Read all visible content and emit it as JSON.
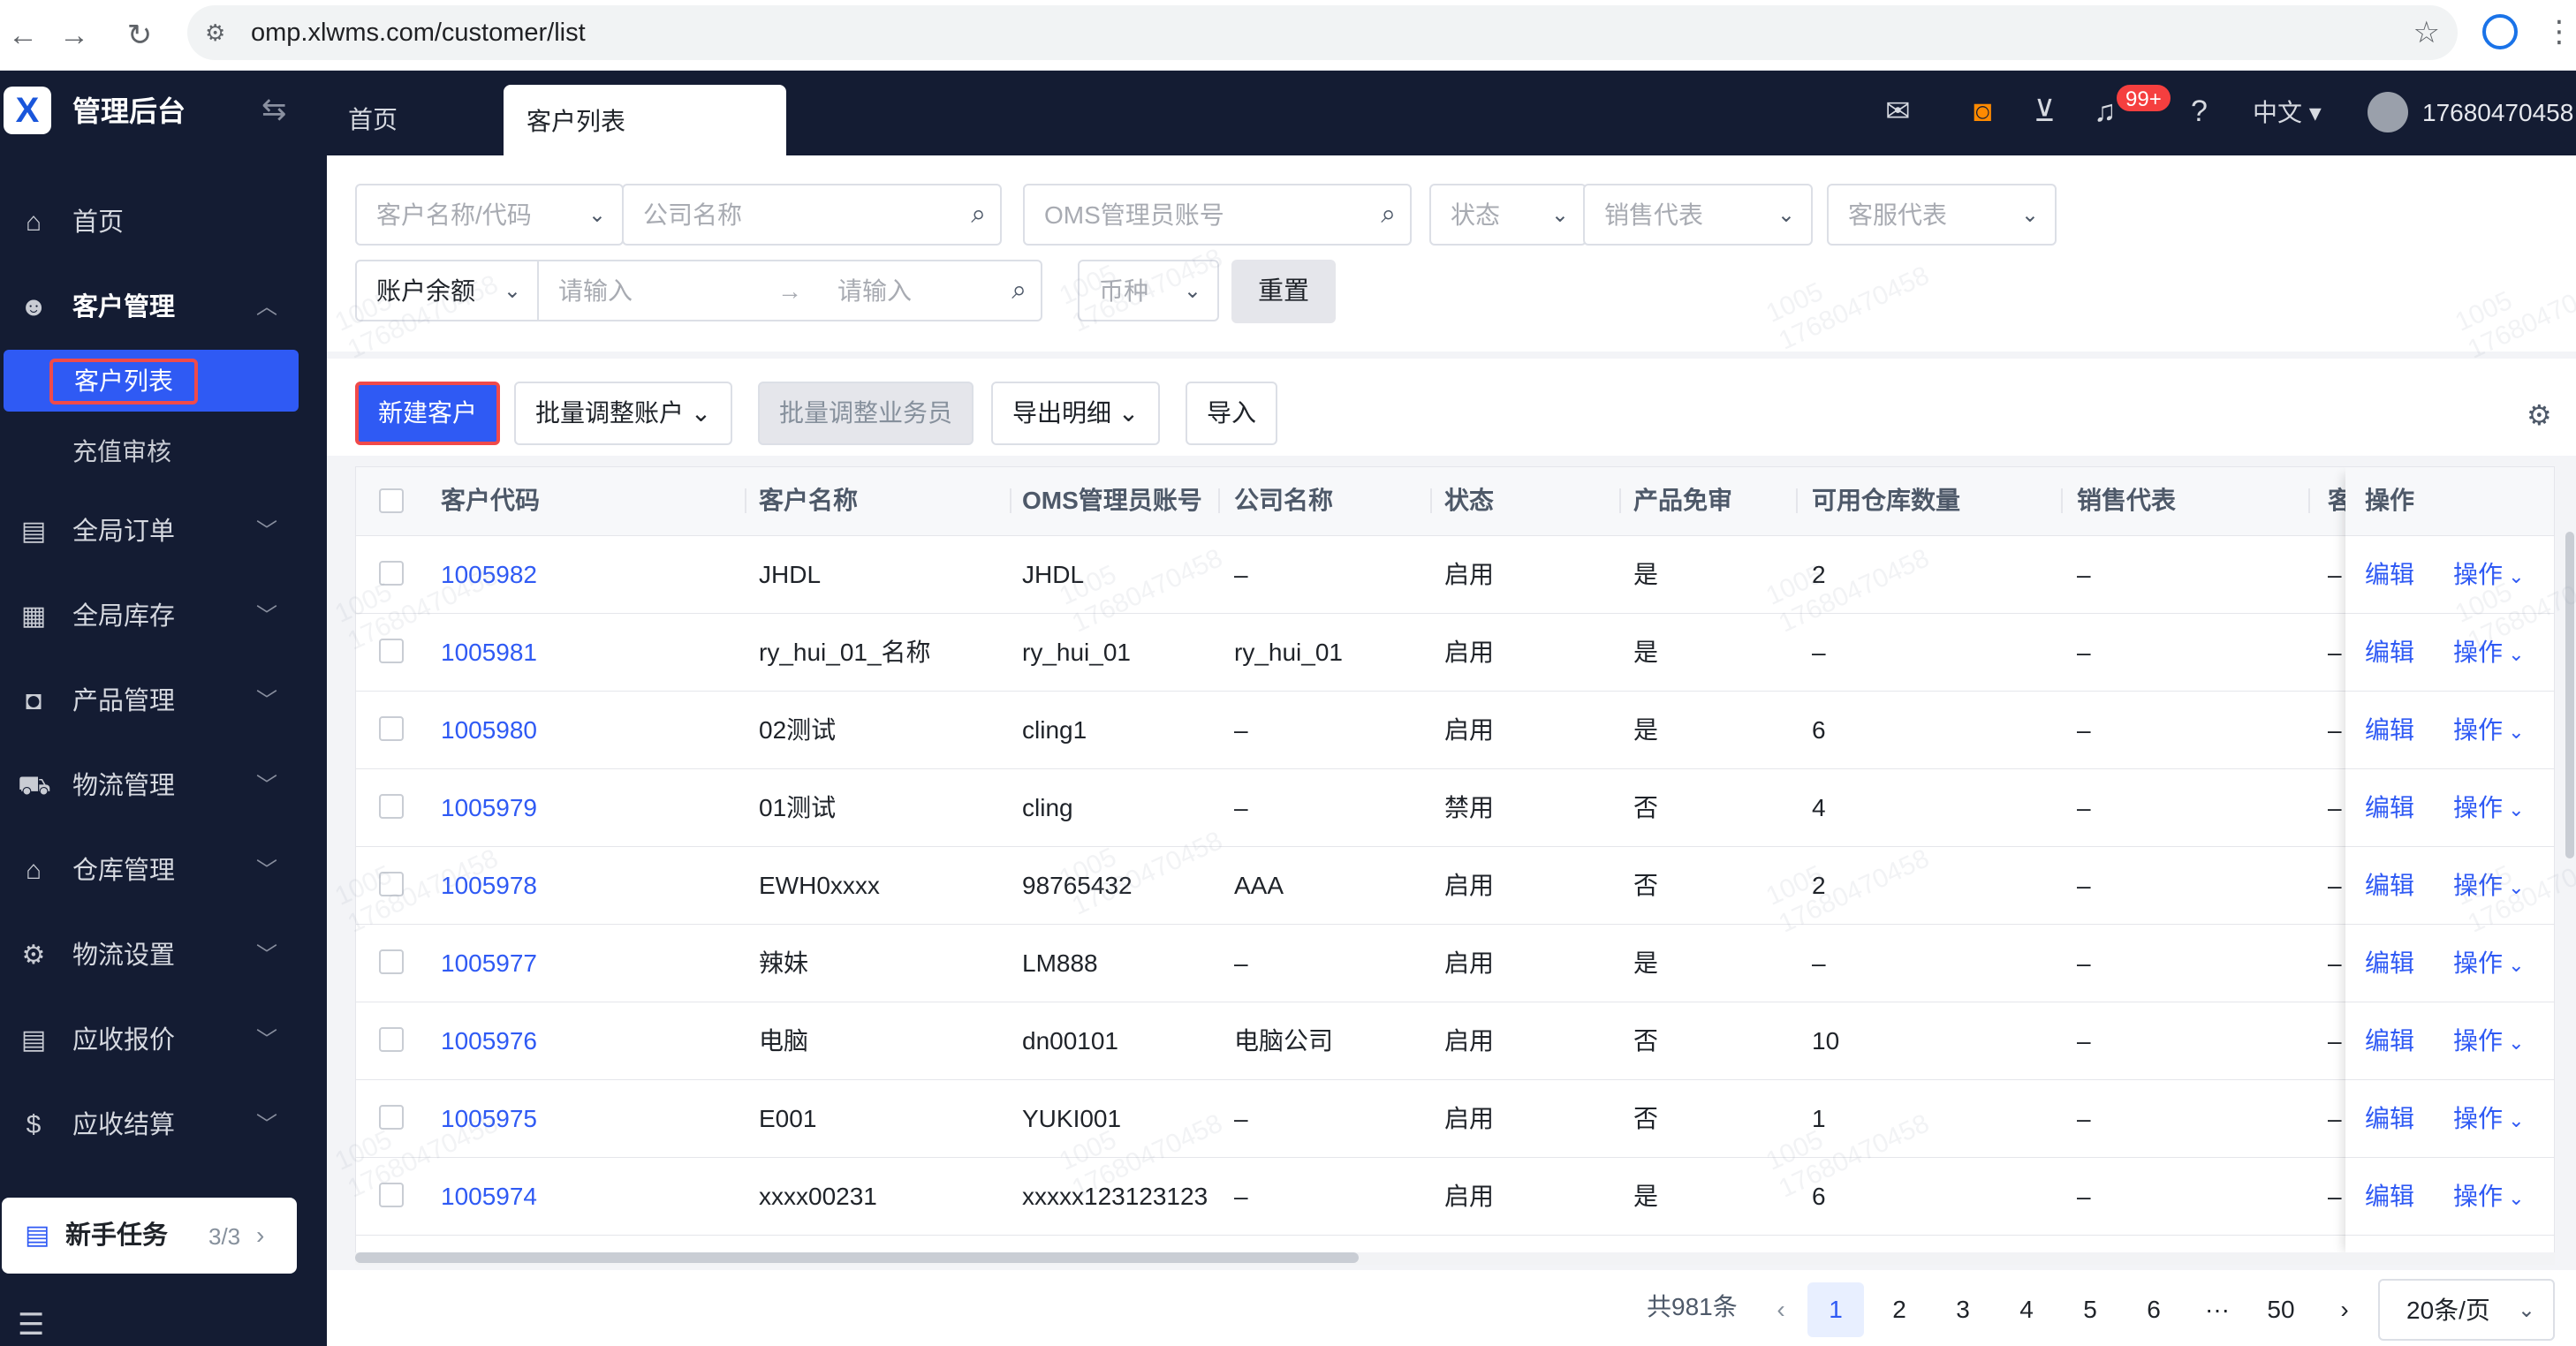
{
  "browser": {
    "url": "omp.xlwms.com/customer/list"
  },
  "header": {
    "brand": "管理后台",
    "tabs": [
      {
        "label": "首页"
      },
      {
        "label": "客户列表"
      }
    ],
    "notification_badge": "99+",
    "language": "中文",
    "username": "17680470458"
  },
  "sidebar": {
    "items": [
      {
        "label": "首页",
        "icon": "home-icon"
      },
      {
        "label": "客户管理",
        "icon": "users-icon"
      },
      {
        "label": "全局订单",
        "icon": "clipboard-icon"
      },
      {
        "label": "全局库存",
        "icon": "warehouse-icon"
      },
      {
        "label": "产品管理",
        "icon": "bag-icon"
      },
      {
        "label": "物流管理",
        "icon": "truck-icon"
      },
      {
        "label": "仓库管理",
        "icon": "house-icon"
      },
      {
        "label": "物流设置",
        "icon": "box-gear-icon"
      },
      {
        "label": "应收报价",
        "icon": "document-icon"
      },
      {
        "label": "应收结算",
        "icon": "dollar-icon"
      }
    ],
    "subitems": [
      {
        "label": "客户列表"
      },
      {
        "label": "充值审核"
      }
    ],
    "task": {
      "label": "新手任务",
      "count": "3/3"
    }
  },
  "filters": {
    "customer": "客户名称/代码",
    "company": "公司名称",
    "oms_account": "OMS管理员账号",
    "status": "状态",
    "sales": "销售代表",
    "service": "客服代表",
    "balance": "账户余额",
    "min": "请输入",
    "max": "请输入",
    "currency": "币种",
    "reset": "重置"
  },
  "toolbar": {
    "new_customer": "新建客户",
    "batch_account": "批量调整账户",
    "batch_sales": "批量调整业务员",
    "export": "导出明细",
    "import": "导入"
  },
  "table": {
    "columns": [
      "客户代码",
      "客户名称",
      "OMS管理员账号",
      "公司名称",
      "状态",
      "产品免审",
      "可用仓库数量",
      "销售代表",
      "客",
      "操作"
    ],
    "rows": [
      {
        "code": "1005982",
        "name": "JHDL",
        "oms": "JHDL",
        "company": "–",
        "status": "启用",
        "free": "是",
        "wh": "2",
        "sales": "–",
        "svc": "–"
      },
      {
        "code": "1005981",
        "name": "ry_hui_01_名称",
        "oms": "ry_hui_01",
        "company": "ry_hui_01",
        "status": "启用",
        "free": "是",
        "wh": "–",
        "sales": "–",
        "svc": "–"
      },
      {
        "code": "1005980",
        "name": "02测试",
        "oms": "cling1",
        "company": "–",
        "status": "启用",
        "free": "是",
        "wh": "6",
        "sales": "–",
        "svc": "–"
      },
      {
        "code": "1005979",
        "name": "01测试",
        "oms": "cling",
        "company": "–",
        "status": "禁用",
        "free": "否",
        "wh": "4",
        "sales": "–",
        "svc": "–"
      },
      {
        "code": "1005978",
        "name": "EWH0xxxx",
        "oms": "98765432",
        "company": "AAA",
        "status": "启用",
        "free": "否",
        "wh": "2",
        "sales": "–",
        "svc": "–"
      },
      {
        "code": "1005977",
        "name": "辣妹",
        "oms": "LM888",
        "company": "–",
        "status": "启用",
        "free": "是",
        "wh": "–",
        "sales": "–",
        "svc": "–"
      },
      {
        "code": "1005976",
        "name": "电脑",
        "oms": "dn00101",
        "company": "电脑公司",
        "status": "启用",
        "free": "否",
        "wh": "10",
        "sales": "–",
        "svc": "–"
      },
      {
        "code": "1005975",
        "name": "E001",
        "oms": "YUKI001",
        "company": "–",
        "status": "启用",
        "free": "否",
        "wh": "1",
        "sales": "–",
        "svc": "–"
      },
      {
        "code": "1005974",
        "name": "xxxx00231",
        "oms": "xxxxx123123123",
        "company": "–",
        "status": "启用",
        "free": "是",
        "wh": "6",
        "sales": "–",
        "svc": "–"
      }
    ],
    "edit": "编辑",
    "ops": "操作"
  },
  "pagination": {
    "total": "共981条",
    "pages": [
      "1",
      "2",
      "3",
      "4",
      "5",
      "6",
      "···",
      "50"
    ],
    "current": "1",
    "page_size": "20条/页"
  },
  "watermark": {
    "line1": "1005",
    "line2": "17680470458"
  },
  "colors": {
    "sidebar_bg": "#141c33",
    "primary": "#2f5af4",
    "highlight_border": "#f04a4a"
  }
}
